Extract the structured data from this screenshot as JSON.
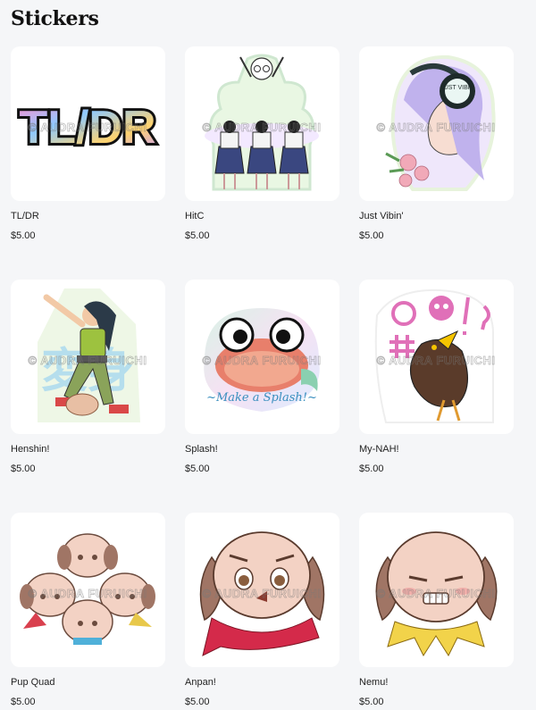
{
  "page": {
    "title": "Stickers"
  },
  "watermark": "© AUDRA FURUICHI",
  "products": [
    {
      "name": "TL/DR",
      "price": "$5.00",
      "art_text": "TL/DR"
    },
    {
      "name": "HitC",
      "price": "$5.00"
    },
    {
      "name": "Just Vibin'",
      "price": "$5.00",
      "art_text": "JUST VIBIN"
    },
    {
      "name": "Henshin!",
      "price": "$5.00",
      "art_text": "変身"
    },
    {
      "name": "Splash!",
      "price": "$5.00",
      "art_text": "~Make a Splash!~"
    },
    {
      "name": "My-NAH!",
      "price": "$5.00"
    },
    {
      "name": "Pup Quad",
      "price": "$5.00"
    },
    {
      "name": "Anpan!",
      "price": "$5.00"
    },
    {
      "name": "Nemu!",
      "price": "$5.00"
    }
  ]
}
